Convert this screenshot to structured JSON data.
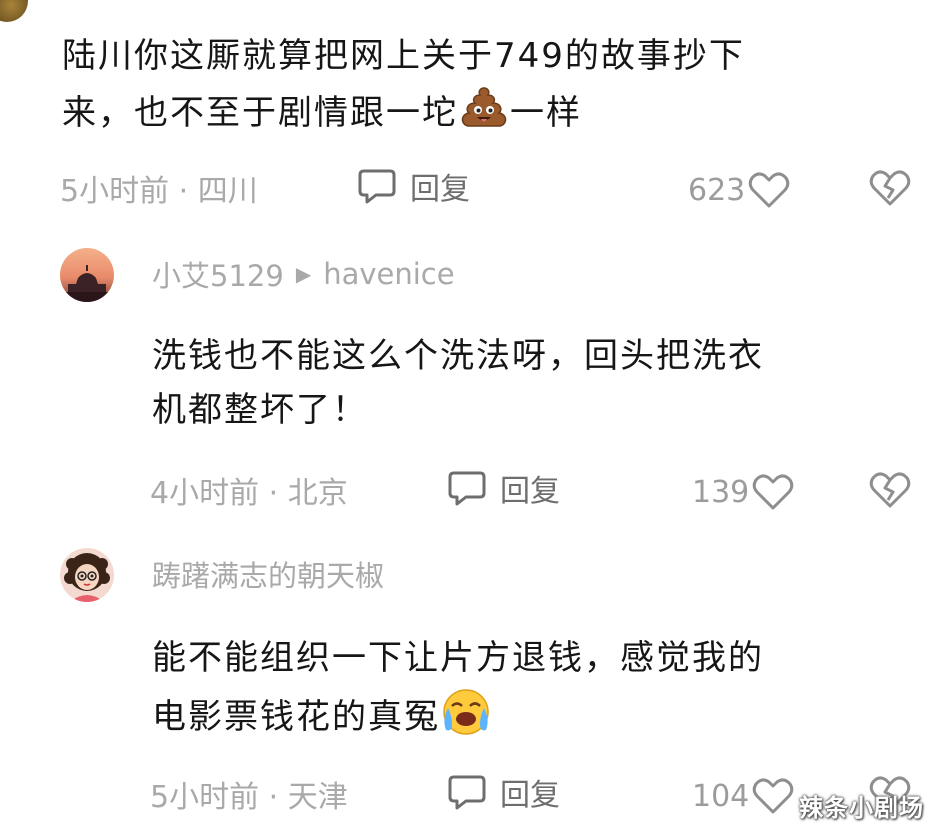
{
  "comments": [
    {
      "text_line1": "陆川你这厮就算把网上关于749的故事抄下",
      "text_line2_pre": "来，也不至于剧情跟一坨",
      "text_line2_emoji": "poop-emoji",
      "text_line2_post": "一样",
      "meta": "5小时前 · 四川",
      "reply_label": "回复",
      "likes": "623"
    }
  ],
  "replies": [
    {
      "username": "小艾5129",
      "reply_to": "havenice",
      "arrow_icon": "triangle-right-icon",
      "text_line1": "洗钱也不能这么个洗法呀，回头把洗衣",
      "text_line2": "机都整坏了！",
      "meta": "4小时前 · 北京",
      "reply_label": "回复",
      "likes": "139"
    },
    {
      "username": "踌躇满志的朝天椒",
      "text_line1": "能不能组织一下让片方退钱，感觉我的",
      "text_line2_pre": "电影票钱花的真冤",
      "text_line2_emoji": "crying-face-emoji",
      "meta": "5小时前 · 天津",
      "reply_label": "回复",
      "likes": "104"
    }
  ],
  "watermark": "辣条小剧场",
  "colors": {
    "meta_gray": "#a9a9a9",
    "text": "#161616",
    "icon_gray": "#6e6e6e"
  }
}
